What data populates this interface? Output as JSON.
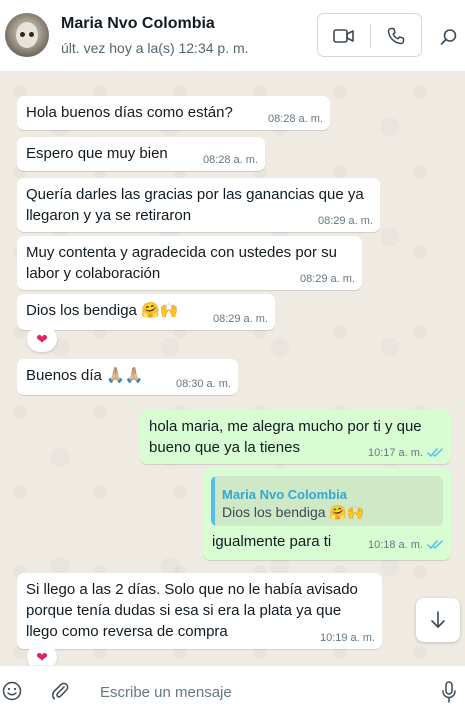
{
  "contact": {
    "name": "Maria Nvo Colombia",
    "last_seen": "últ. vez hoy a la(s) 12:34 p. m."
  },
  "header_icons": {
    "video": "video-call-icon",
    "phone": "voice-call-icon",
    "search": "search-icon"
  },
  "messages": [
    {
      "direction": "in",
      "text": "Hola buenos días como están?",
      "time": "08:28 a. m."
    },
    {
      "direction": "in",
      "text": "Espero que muy bien",
      "time": "08:28 a. m."
    },
    {
      "direction": "in",
      "lines": [
        "Quería darles las gracias por las ganancias que ya",
        "llegaron y ya se retiraron"
      ],
      "time": "08:29 a. m."
    },
    {
      "direction": "in",
      "lines": [
        "Muy contenta y agradecida con ustedes por su",
        "labor y colaboración"
      ],
      "time": "08:29 a. m."
    },
    {
      "direction": "in",
      "text": "Dios los bendiga 🤗🙌",
      "time": "08:29 a. m.",
      "reaction": "❤"
    },
    {
      "direction": "in",
      "text": "Buenos día 🙏🏼🙏🏼",
      "time": "08:30 a. m."
    },
    {
      "direction": "out",
      "lines": [
        "hola maria, me alegra mucho por ti y que",
        "bueno que ya la tienes"
      ],
      "time": "10:17 a. m.",
      "status": "read"
    },
    {
      "direction": "out",
      "quoted": {
        "name": "Maria Nvo Colombia",
        "text": "Dios los bendiga 🤗🙌"
      },
      "text": "igualmente para ti",
      "time": "10:18 a. m.",
      "status": "read"
    },
    {
      "direction": "in",
      "lines": [
        "Si llego a las 2 días.  Solo que no le había avisado",
        "porque tenía dudas si esa si era la plata ya que",
        "llego como reversa de compra"
      ],
      "time": "10:19 a. m.",
      "reaction": "❤"
    }
  ],
  "composer": {
    "placeholder": "Escribe un mensaje"
  },
  "colors": {
    "incoming_bubble": "#ffffff",
    "outgoing_bubble": "#d9fdd3",
    "chat_background": "#efeae2",
    "read_check": "#53bdeb",
    "quote_name": "#35a7cf"
  }
}
